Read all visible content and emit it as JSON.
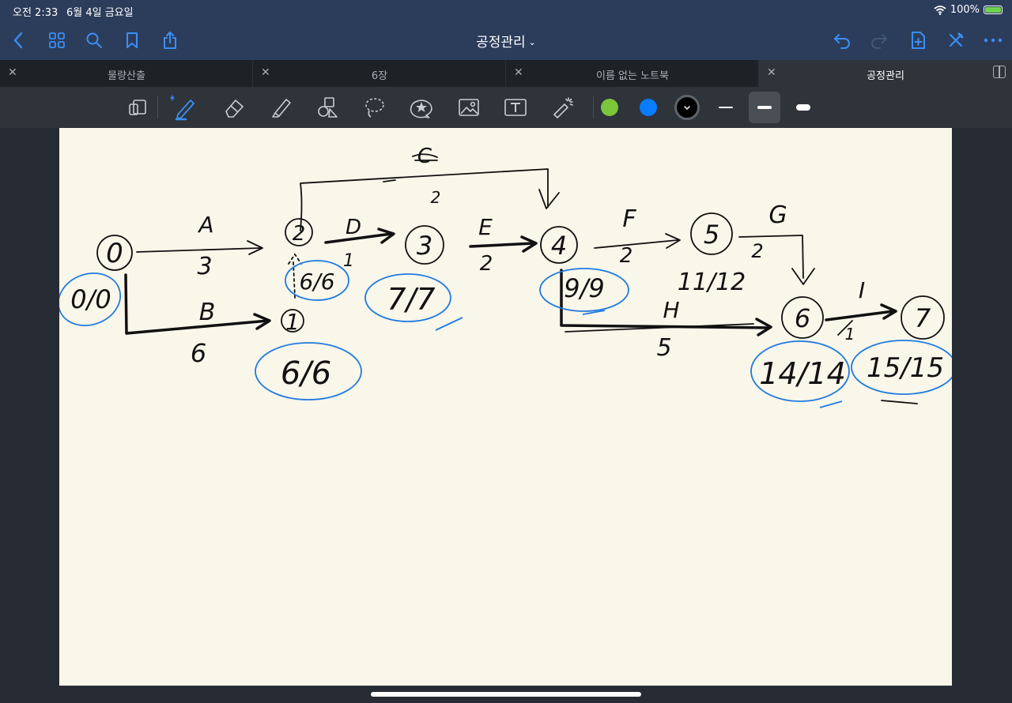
{
  "status_bar": {
    "time": "오전 2:33",
    "date": "6월 4일 금요일",
    "battery": "100%"
  },
  "nav": {
    "title": "공정관리",
    "left_icons": [
      "back-icon",
      "grid-icon",
      "search-icon",
      "bookmark-icon",
      "share-icon"
    ],
    "right_icons": [
      "undo-icon",
      "redo-icon",
      "add-page-icon",
      "close-pen-icon",
      "more-icon"
    ]
  },
  "tabs": [
    {
      "label": "물량산출",
      "active": false
    },
    {
      "label": "6장",
      "active": false
    },
    {
      "label": "이름 없는 노트북",
      "active": false
    },
    {
      "label": "공정관리",
      "active": true
    }
  ],
  "toolbar": {
    "tools": [
      "page-layout-icon",
      "pen-icon",
      "eraser-icon",
      "highlighter-icon",
      "shapes-icon",
      "lasso-icon",
      "sticker-icon",
      "image-icon",
      "text-icon",
      "laser-pointer-icon"
    ],
    "selected_tool": "pen-icon",
    "colors": [
      "#7bc63a",
      "#0a7cff",
      "#000000"
    ],
    "selected_color": "#000000",
    "stroke_widths": [
      "thin",
      "medium",
      "thick"
    ],
    "selected_width": "medium"
  },
  "canvas": {
    "nodes": [
      "0",
      "2",
      "3",
      "4",
      "5",
      "6",
      "7",
      "1"
    ],
    "activities": [
      {
        "letter": "A",
        "duration": "3"
      },
      {
        "letter": "B",
        "duration": "6"
      },
      {
        "letter": "C",
        "duration": "2"
      },
      {
        "letter": "D",
        "duration": "1"
      },
      {
        "letter": "E",
        "duration": "2"
      },
      {
        "letter": "F",
        "duration": "2"
      },
      {
        "letter": "G",
        "duration": "2"
      },
      {
        "letter": "H",
        "duration": "5"
      },
      {
        "letter": "I",
        "duration": "1"
      }
    ],
    "times": [
      "0/0",
      "6/6",
      "6/6",
      "7/7",
      "9/9",
      "11/12",
      "14/14",
      "15/15"
    ],
    "ink_colors": {
      "black": "#111111",
      "blue": "#1f7ae0"
    }
  }
}
